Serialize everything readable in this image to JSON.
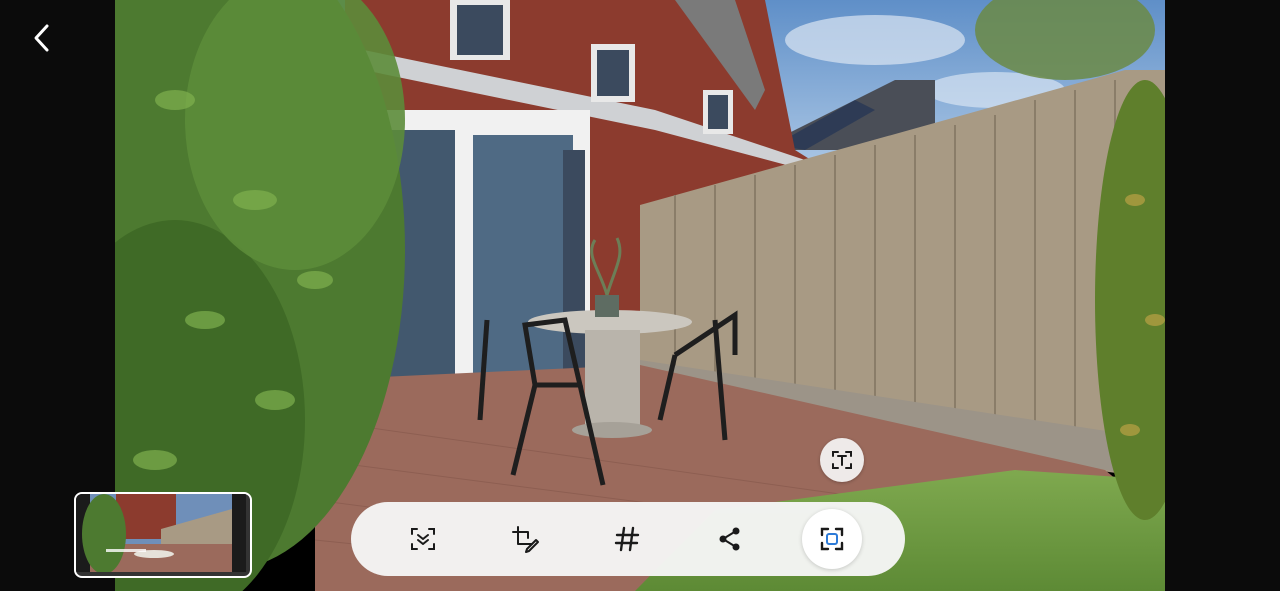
{
  "viewer": {
    "photo_subject": "backyard-patio-photo",
    "navigation": {
      "back_icon": "chevron-left-icon"
    },
    "overlay": {
      "text_extract_icon": "text-scan-icon"
    },
    "thumbnail": {
      "icon": "photo-thumbnail"
    },
    "toolbar": {
      "items": [
        {
          "name": "smart-select-icon",
          "active": false
        },
        {
          "name": "crop-edit-icon",
          "active": false
        },
        {
          "name": "hashtag-icon",
          "active": false
        },
        {
          "name": "share-icon",
          "active": false
        },
        {
          "name": "screen-capture-icon",
          "active": true
        }
      ]
    },
    "colors": {
      "toolbar_bg": "#f6f6f6",
      "icon": "#1a1a1a",
      "active_icon": "#2d7bd8",
      "grass": "#7fa94f",
      "fence": "#a89a84",
      "brick": "#8c3b2e"
    }
  }
}
